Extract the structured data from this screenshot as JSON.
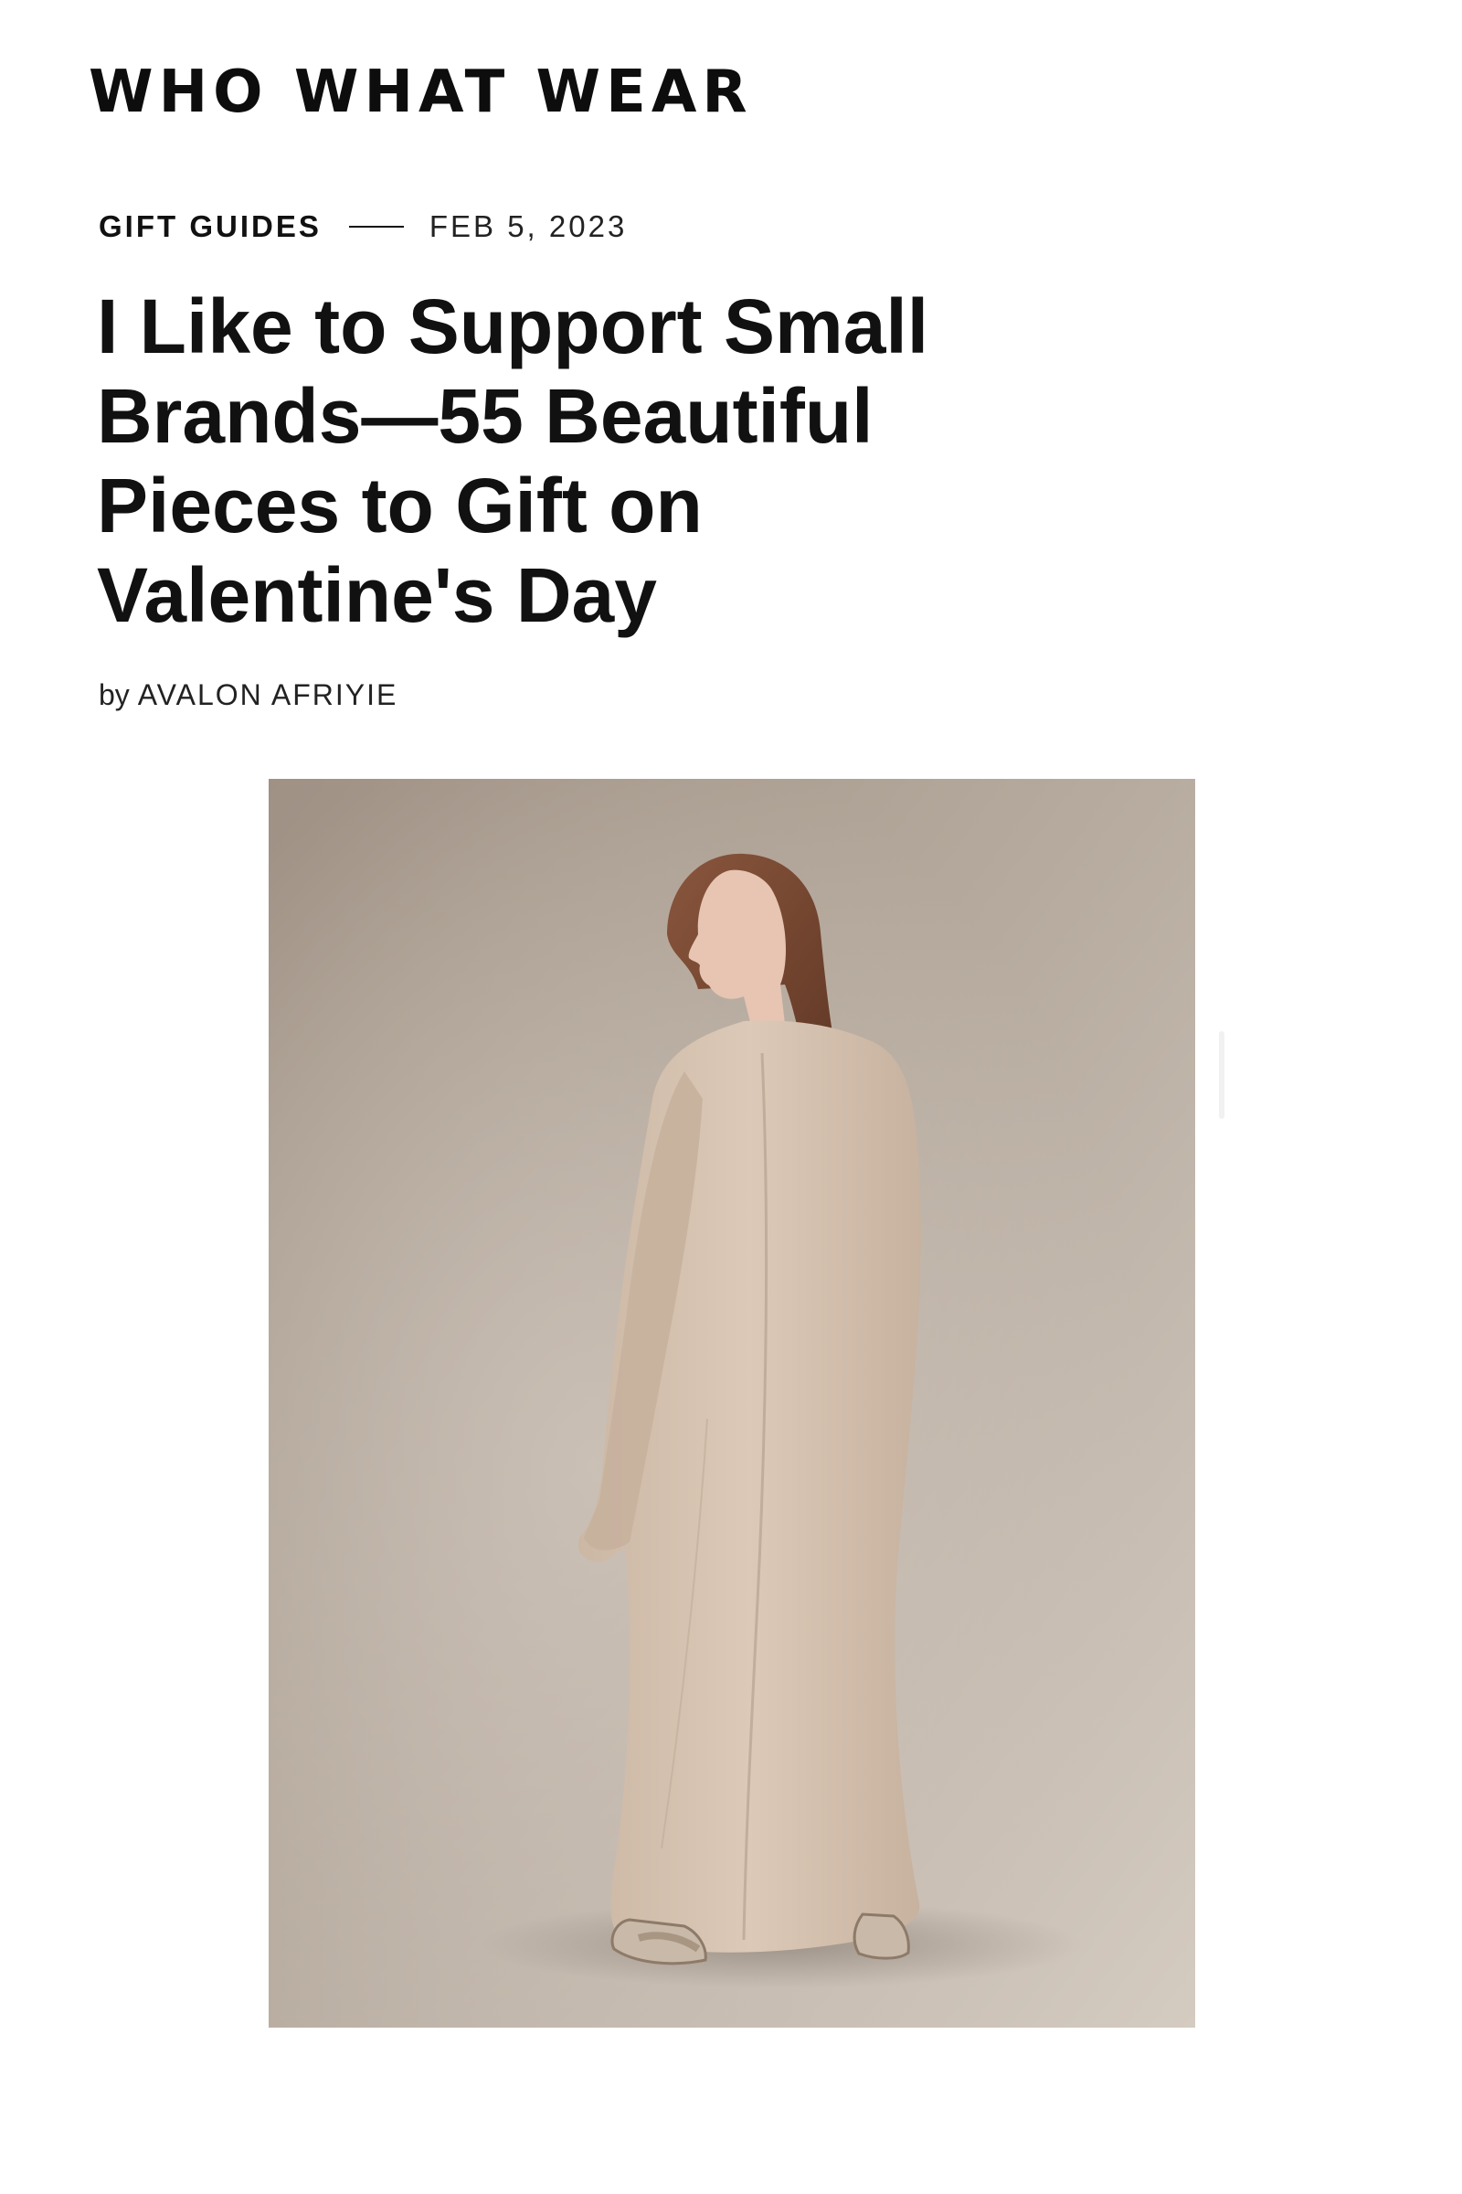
{
  "site": {
    "logo_text": "WHO WHAT WEAR"
  },
  "article": {
    "category": "GIFT GUIDES",
    "date": "FEB 5, 2023",
    "title_lines": [
      "I Like to Support Small",
      "Brands—55 Beautiful",
      "Pieces to Gift on",
      "Valentine's Day"
    ],
    "byline_prefix": "by",
    "author": "AVALON AFRIYIE"
  },
  "hero_image": {
    "subject": "model-in-long-beige-knit-cardigan",
    "colors": {
      "backdrop": "#b8ada2",
      "garment": "#d6c3b1",
      "hair": "#7a4a35",
      "skin": "#e9c8b5",
      "sandal": "#c9b9a8"
    }
  }
}
